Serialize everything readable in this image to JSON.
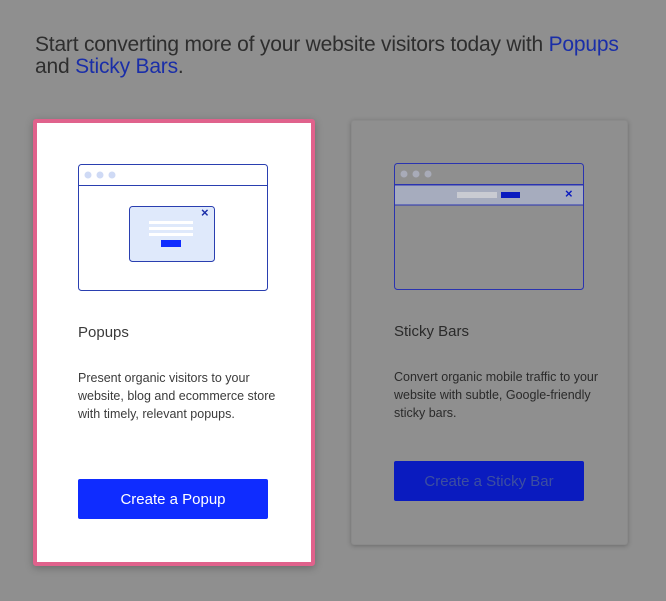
{
  "headline": {
    "prefix": "Start converting more of your website visitors today with ",
    "link_popups": "Popups",
    "middle": " and ",
    "link_sticky": "Sticky Bars",
    "suffix": "."
  },
  "cards": {
    "popup": {
      "title": "Popups",
      "description": "Present organic visitors to your website, blog and ecommerce store with timely, relevant popups.",
      "button": "Create a Popup",
      "close_glyph": "×"
    },
    "sticky": {
      "title": "Sticky Bars",
      "description": "Convert organic mobile traffic to your website with subtle, Google-friendly sticky bars.",
      "button": "Create a Sticky Bar",
      "close_glyph": "×"
    }
  },
  "colors": {
    "accent": "#0f2cff",
    "highlight_border": "#e0628c",
    "overlay": "#8f8f8f"
  }
}
